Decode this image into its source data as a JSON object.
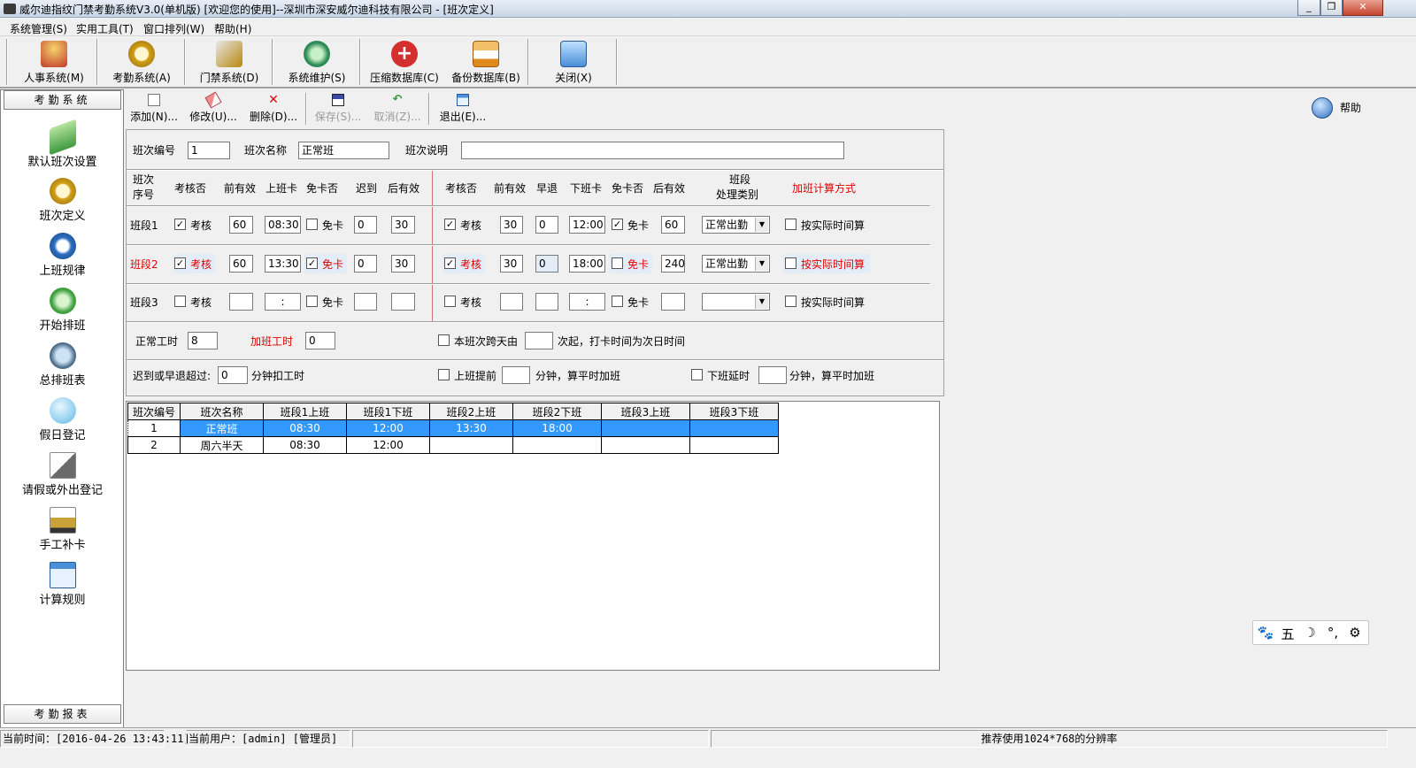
{
  "window": {
    "title": "威尔迪指纹门禁考勤系统V3.0(单机版) [欢迎您的使用]--深圳市深安威尔迪科技有限公司 - [班次定义]",
    "minimize": "_",
    "restore": "❐",
    "close": "✕"
  },
  "menu": [
    "系统管理(S)",
    "实用工具(T)",
    "窗口排列(W)",
    "帮助(H)"
  ],
  "toolbar": [
    {
      "label": "人事系统(M)",
      "icon": "people-icon",
      "color": "#c0392b"
    },
    {
      "label": "考勤系统(A)",
      "icon": "clock-icon",
      "color": "#d4a017"
    },
    {
      "label": "门禁系统(D)",
      "icon": "tools-icon",
      "color": "#b8860b"
    },
    {
      "label": "系统维护(S)",
      "icon": "recycle-icon",
      "color": "#2e8b57"
    },
    {
      "label": "压缩数据库(C)",
      "icon": "first-aid-icon",
      "color": "#d32f2f"
    },
    {
      "label": "备份数据库(B)",
      "icon": "floppy-icon",
      "color": "#e08a1e"
    },
    {
      "label": "关闭(X)",
      "icon": "exit-card-icon",
      "color": "#4a8fd8"
    }
  ],
  "leftnav": {
    "header": "考勤系统",
    "footer": "考勤报表",
    "items": [
      {
        "label": "默认班次设置",
        "icon": "book-icon",
        "color": "#3f9a3f"
      },
      {
        "label": "班次定义",
        "icon": "clock-icon",
        "color": "#d4a017"
      },
      {
        "label": "上班规律",
        "icon": "compass-icon",
        "color": "#2a6fbf"
      },
      {
        "label": "开始排班",
        "icon": "recycle-icon",
        "color": "#3fa03f"
      },
      {
        "label": "总排班表",
        "icon": "globe-icon",
        "color": "#4a6a8a"
      },
      {
        "label": "假日登记",
        "icon": "sphere-icon",
        "color": "#5fb7e6"
      },
      {
        "label": "请假或外出登记",
        "icon": "pen-paper-icon",
        "color": "#6a6a6a"
      },
      {
        "label": "手工补卡",
        "icon": "fountain-pen-icon",
        "color": "#caa23a"
      },
      {
        "label": "计算规则",
        "icon": "window-icon",
        "color": "#4a8fd8"
      }
    ]
  },
  "subtoolbar": [
    {
      "label": "添加(N)...",
      "icon": "new-doc-icon",
      "enabled": true
    },
    {
      "label": "修改(U)...",
      "icon": "eraser-icon",
      "enabled": true
    },
    {
      "label": "删除(D)...",
      "icon": "delete-x-icon",
      "enabled": true
    },
    {
      "label": "保存(S)...",
      "icon": "save-icon",
      "enabled": false
    },
    {
      "label": "取消(Z)...",
      "icon": "undo-icon",
      "enabled": false
    },
    {
      "label": "退出(E)...",
      "icon": "exit-icon",
      "enabled": true
    }
  ],
  "help": "帮助",
  "form": {
    "code_label": "班次编号",
    "code_value": "1",
    "name_label": "班次名称",
    "name_value": "正常班",
    "desc_label": "班次说明",
    "desc_value": "",
    "headers": {
      "seq_line1": "班次",
      "seq_line2": "序号",
      "check": "考核否",
      "before_valid": "前有效",
      "clock_in": "上班卡",
      "exempt": "免卡否",
      "late": "迟到",
      "after_valid": "后有效",
      "check2": "考核否",
      "before_valid2": "前有效",
      "early": "早退",
      "clock_out": "下班卡",
      "exempt2": "免卡否",
      "after_valid2": "后有效",
      "type_line1": "班段",
      "type_line2": "处理类别",
      "ot_method": "加班计算方式"
    },
    "check_text": "考核",
    "exempt_text": "免卡",
    "actual_time_text": "按实际时间算",
    "rows": [
      {
        "name": "班段1",
        "in_check": true,
        "in_before": "60",
        "in_time": "08:30",
        "in_exempt": false,
        "late": "0",
        "in_after": "30",
        "out_check": true,
        "out_before": "30",
        "early": "0",
        "out_time": "12:00",
        "out_exempt": true,
        "out_after": "60",
        "type": "正常出勤",
        "actual": false
      },
      {
        "name": "班段2",
        "in_check": true,
        "in_before": "60",
        "in_time": "13:30",
        "in_exempt": true,
        "late": "0",
        "in_after": "30",
        "out_check": true,
        "out_before": "30",
        "early": "0",
        "out_time": "18:00",
        "out_exempt": false,
        "out_after": "240",
        "type": "正常出勤",
        "actual": false
      },
      {
        "name": "班段3",
        "in_check": false,
        "in_before": "",
        "in_time": " : ",
        "in_exempt": false,
        "late": "",
        "in_after": "",
        "out_check": false,
        "out_before": "",
        "early": "",
        "out_time": " : ",
        "out_exempt": false,
        "out_after": "",
        "type": "",
        "actual": false
      }
    ],
    "normal_hours_label": "正常工时",
    "normal_hours_value": "8",
    "ot_hours_label": "加班工时",
    "ot_hours_value": "0",
    "cross_day_prefix": "本班次跨天由",
    "cross_day_value": "",
    "cross_day_suffix": "次起，打卡时间为次日时间",
    "late_early_label": "迟到或早退超过:",
    "late_early_value": "0",
    "late_early_suffix": "分钟扣工时",
    "early_start_label": "上班提前",
    "early_start_value": "",
    "early_start_suffix": "分钟，算平时加班",
    "delay_label": "下班延时",
    "delay_value": "",
    "delay_suffix": "分钟，算平时加班"
  },
  "grid": {
    "columns": [
      "班次编号",
      "班次名称",
      "班段1上班",
      "班段1下班",
      "班段2上班",
      "班段2下班",
      "班段3上班",
      "班段3下班"
    ],
    "rows": [
      [
        "1",
        "正常班",
        "08:30",
        "12:00",
        "13:30",
        "18:00",
        "",
        ""
      ],
      [
        "2",
        "周六半天",
        "08:30",
        "12:00",
        "",
        "",
        "",
        ""
      ]
    ],
    "selected_row": 0
  },
  "ime": [
    "🐾",
    "五",
    "☽",
    "°,",
    "⚙"
  ],
  "status": {
    "time": "当前时间：[2016-04-26 13:43:11]",
    "user": "当前用户：[admin] [管理员]",
    "blank": "",
    "hint": "推荐使用1024*768的分辨率"
  }
}
